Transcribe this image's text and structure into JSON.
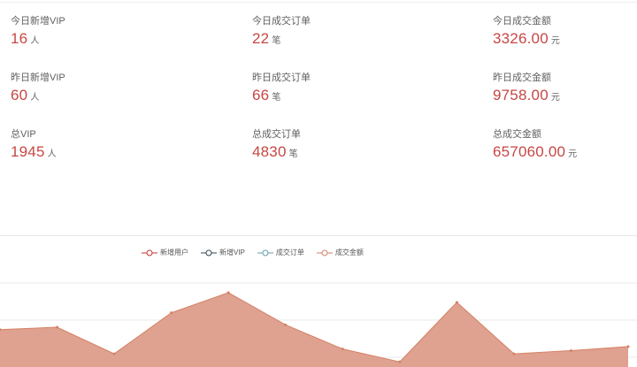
{
  "stats": [
    [
      {
        "label": "今日新增VIP",
        "value": "16",
        "unit": "人"
      },
      {
        "label": "今日成交订单",
        "value": "22",
        "unit": "笔"
      },
      {
        "label": "今日成交金额",
        "value": "3326.00",
        "unit": "元"
      }
    ],
    [
      {
        "label": "昨日新增VIP",
        "value": "60",
        "unit": "人"
      },
      {
        "label": "昨日成交订单",
        "value": "66",
        "unit": "笔"
      },
      {
        "label": "昨日成交金额",
        "value": "9758.00",
        "unit": "元"
      }
    ],
    [
      {
        "label": "总VIP",
        "value": "1945",
        "unit": "人"
      },
      {
        "label": "总成交订单",
        "value": "4830",
        "unit": "笔"
      },
      {
        "label": "总成交金额",
        "value": "657060.00",
        "unit": "元"
      }
    ]
  ],
  "chart_data": {
    "type": "area",
    "legend": [
      {
        "name": "新增用户",
        "color": "#c23531"
      },
      {
        "name": "新增VIP",
        "color": "#2f4554"
      },
      {
        "name": "成交订单",
        "color": "#61a0a8"
      },
      {
        "name": "成交金额",
        "color": "#d48265"
      }
    ],
    "legend_placement": "top-center",
    "series": [
      {
        "name": "成交金额",
        "color": "#d48265",
        "fill": "#dfa190",
        "values": [
          42,
          45,
          12,
          63,
          88,
          48,
          18,
          2,
          76,
          12,
          16,
          21
        ]
      }
    ],
    "ylim": [
      0,
      100
    ],
    "grid": true
  }
}
